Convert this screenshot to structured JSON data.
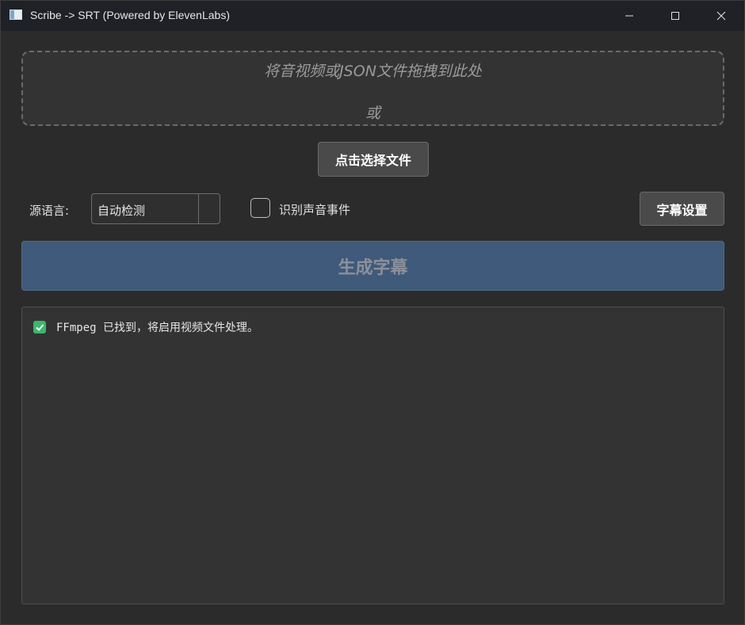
{
  "window": {
    "title": "Scribe -> SRT (Powered by ElevenLabs)"
  },
  "dropzone": {
    "line1": "将音视频或JSON文件拖拽到此处",
    "line2": "或"
  },
  "buttons": {
    "choose_file": "点击选择文件",
    "subtitle_settings": "字幕设置",
    "generate": "生成字幕"
  },
  "source_language": {
    "label": "源语言:",
    "selected": "自动检测"
  },
  "sound_events": {
    "label": "识别声音事件",
    "checked": false
  },
  "log": {
    "lines": [
      {
        "icon": "check-mark-icon",
        "text": "FFmpeg 已找到，将启用视频文件处理。"
      }
    ]
  },
  "colors": {
    "generate_button_bg": "#3f5a7a",
    "success_icon": "#3bb86a"
  }
}
